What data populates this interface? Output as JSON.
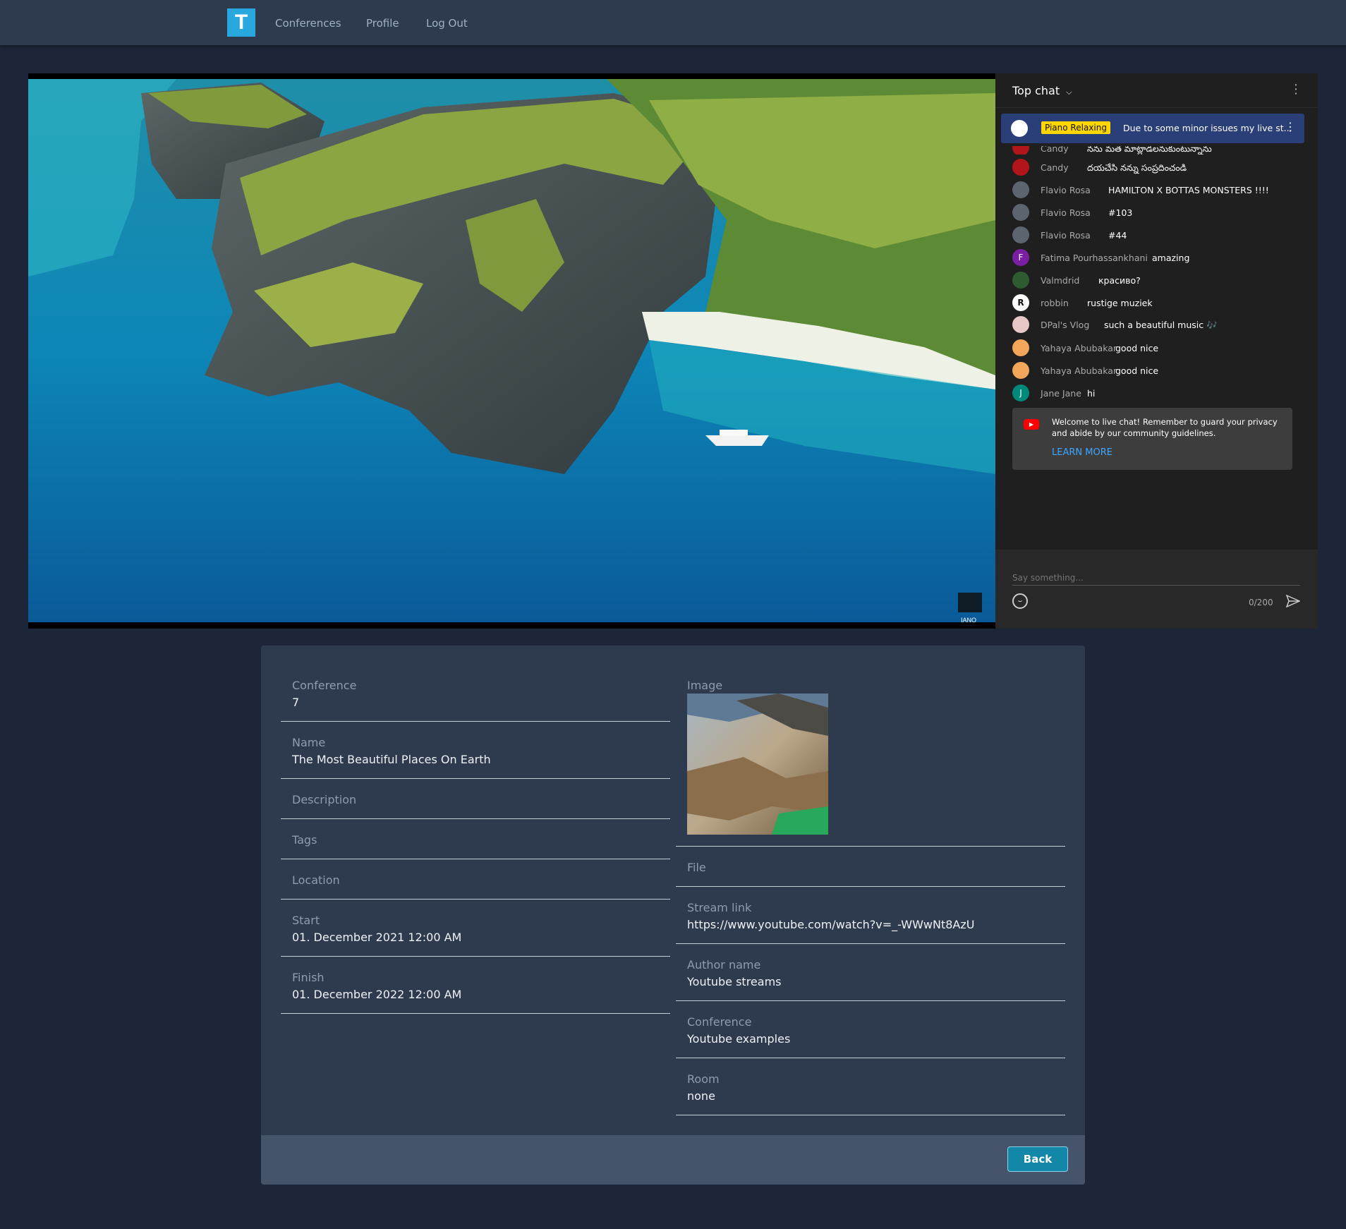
{
  "nav": {
    "logo_letter": "T",
    "links": [
      "Conferences",
      "Profile",
      "Log Out"
    ]
  },
  "video": {
    "watermark": "IANO"
  },
  "chat": {
    "title": "Top chat",
    "pinned": {
      "badge": "Piano Relaxing",
      "text": "Due to some minor issues my live st..."
    },
    "messages": [
      {
        "author": "Candy",
        "text": "నను మత మాట్లాడలనుకుంటున్నాను",
        "avatar_color": "#b2161b",
        "avatar_letter": ""
      },
      {
        "author": "Candy",
        "text": "దయచేసి నన్ను సంప్రదించండి",
        "avatar_color": "#b2161b",
        "avatar_letter": ""
      },
      {
        "author": "Flavio Rosa",
        "text": "HAMILTON X BOTTAS MONSTERS !!!!",
        "avatar_color": "#5c6470",
        "avatar_letter": ""
      },
      {
        "author": "Flavio Rosa",
        "text": "#103",
        "avatar_color": "#5c6470",
        "avatar_letter": ""
      },
      {
        "author": "Flavio Rosa",
        "text": "#44",
        "avatar_color": "#5c6470",
        "avatar_letter": ""
      },
      {
        "author": "Fatima Pourhassankhani",
        "text": "amazing",
        "avatar_color": "#7b1fa2",
        "avatar_letter": "F"
      },
      {
        "author": "Valmdrid",
        "text": "красиво?",
        "avatar_color": "#2e5b2f",
        "avatar_letter": ""
      },
      {
        "author": "robbin",
        "text": "rustige muziek",
        "avatar_color": "#ffffff",
        "avatar_letter": "R"
      },
      {
        "author": "DPal's Vlog",
        "text": "such a beautiful music 🎶",
        "avatar_color": "#e8c7c7",
        "avatar_letter": ""
      },
      {
        "author": "Yahaya Abubakar",
        "text": "good nice",
        "avatar_color": "#f2a65a",
        "avatar_letter": ""
      },
      {
        "author": "Yahaya Abubakar",
        "text": "good nice",
        "avatar_color": "#f2a65a",
        "avatar_letter": ""
      },
      {
        "author": "Jane Jane",
        "text": "hi",
        "avatar_color": "#00897b",
        "avatar_letter": "J"
      }
    ],
    "welcome": {
      "text": "Welcome to live chat! Remember to guard your privacy and abide by our community guidelines.",
      "link": "LEARN MORE"
    },
    "input_placeholder": "Say something...",
    "char_count": "0/200"
  },
  "details": {
    "left": [
      {
        "label": "Conference",
        "value": "7"
      },
      {
        "label": "Name",
        "value": "The Most Beautiful Places On Earth"
      },
      {
        "label": "Description",
        "value": ""
      },
      {
        "label": "Tags",
        "value": ""
      },
      {
        "label": "Location",
        "value": ""
      },
      {
        "label": "Start",
        "value": "01. December 2021 12:00 AM"
      },
      {
        "label": "Finish",
        "value": "01. December 2022 12:00 AM"
      }
    ],
    "image_label": "Image",
    "right": [
      {
        "label": "File",
        "value": ""
      },
      {
        "label": "Stream link",
        "value": "https://www.youtube.com/watch?v=_-WWwNt8AzU"
      },
      {
        "label": "Author name",
        "value": "Youtube streams"
      },
      {
        "label": "Conference",
        "value": "Youtube examples"
      },
      {
        "label": "Room",
        "value": "none"
      }
    ],
    "back_label": "Back"
  }
}
